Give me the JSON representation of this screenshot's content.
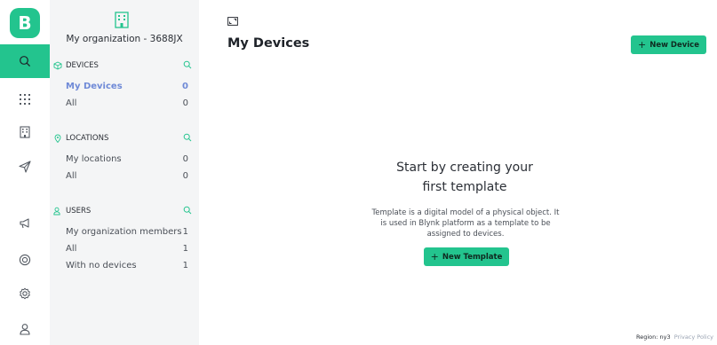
{
  "app": {
    "logo_letter": "B",
    "brand_color": "#23c48e",
    "link_color": "#6f8ad7"
  },
  "rail": {
    "items": [
      {
        "name": "search-icon",
        "active": true
      },
      {
        "name": "grid-icon",
        "active": false
      },
      {
        "name": "building-icon",
        "active": false
      },
      {
        "name": "send-icon",
        "active": false
      },
      {
        "name": "megaphone-icon",
        "active": false
      },
      {
        "name": "lifebuoy-icon",
        "active": false
      },
      {
        "name": "settings-icon",
        "active": false
      },
      {
        "name": "user-icon",
        "active": false
      }
    ]
  },
  "sidebar": {
    "org_name": "My organization - 3688JX",
    "sections": {
      "devices": {
        "title": "DEVICES",
        "items": [
          {
            "label": "My Devices",
            "count": "0"
          },
          {
            "label": "All",
            "count": "0"
          }
        ]
      },
      "locations": {
        "title": "LOCATIONS",
        "items": [
          {
            "label": "My locations",
            "count": "0"
          },
          {
            "label": "All",
            "count": "0"
          }
        ]
      },
      "users": {
        "title": "USERS",
        "items": [
          {
            "label": "My organization members",
            "count": "1"
          },
          {
            "label": "All",
            "count": "1"
          },
          {
            "label": "With no devices",
            "count": "1"
          }
        ]
      }
    }
  },
  "main": {
    "title": "My Devices",
    "new_device_label": "New Device",
    "empty_title_line1": "Start by creating your",
    "empty_title_line2": "first template",
    "empty_desc_line1": "Template is a digital model of a physical object. It",
    "empty_desc_line2": "is used in Blynk platform as a template to be",
    "empty_desc_line3": "assigned to devices.",
    "new_template_label": "New Template"
  },
  "footer": {
    "region": "Region: ny3",
    "privacy": "Privacy Policy"
  }
}
